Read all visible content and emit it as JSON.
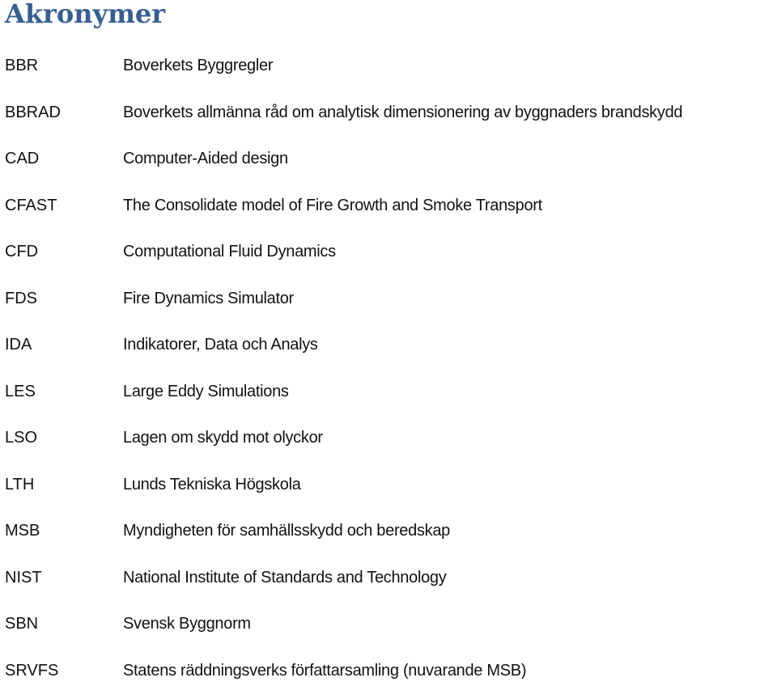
{
  "title": "Akronymer",
  "items": [
    {
      "abbr": "BBR",
      "definition": "Boverkets Byggregler"
    },
    {
      "abbr": "BBRAD",
      "definition": "Boverkets allmänna råd om analytisk dimensionering av byggnaders brandskydd"
    },
    {
      "abbr": "CAD",
      "definition": "Computer-Aided design"
    },
    {
      "abbr": "CFAST",
      "definition": "The Consolidate model of Fire Growth and Smoke Transport"
    },
    {
      "abbr": "CFD",
      "definition": "Computational Fluid Dynamics"
    },
    {
      "abbr": "FDS",
      "definition": "Fire Dynamics Simulator"
    },
    {
      "abbr": "IDA",
      "definition": "Indikatorer, Data och Analys"
    },
    {
      "abbr": "LES",
      "definition": "Large Eddy Simulations"
    },
    {
      "abbr": "LSO",
      "definition": "Lagen om skydd mot olyckor"
    },
    {
      "abbr": "LTH",
      "definition": "Lunds Tekniska Högskola"
    },
    {
      "abbr": "MSB",
      "definition": "Myndigheten för samhällsskydd och beredskap"
    },
    {
      "abbr": "NIST",
      "definition": "National Institute of Standards and Technology"
    },
    {
      "abbr": "SBN",
      "definition": "Svensk Byggnorm"
    },
    {
      "abbr": "SRVFS",
      "definition": "Statens räddningsverks författarsamling (nuvarande MSB)"
    }
  ]
}
